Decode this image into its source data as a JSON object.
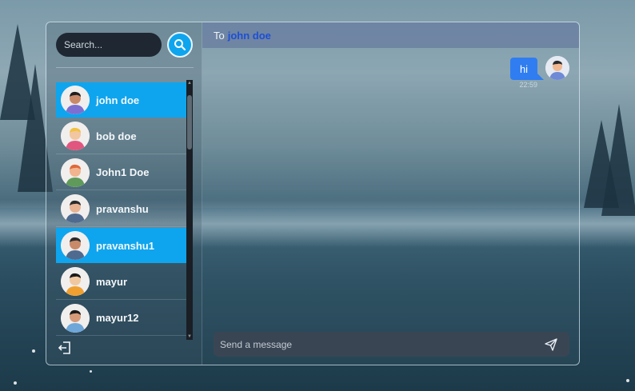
{
  "search": {
    "placeholder": "Search..."
  },
  "contacts": [
    {
      "name": "john doe",
      "active": true
    },
    {
      "name": "bob doe",
      "active": false
    },
    {
      "name": "John1 Doe",
      "active": false
    },
    {
      "name": "pravanshu",
      "active": false
    },
    {
      "name": "pravanshu1",
      "active": true
    },
    {
      "name": "mayur",
      "active": false
    },
    {
      "name": "mayur12",
      "active": false
    }
  ],
  "chat": {
    "to_label": "To",
    "recipient": "john doe",
    "messages": [
      {
        "text": "hi",
        "time": "22:59",
        "outgoing": true
      }
    ],
    "composer_placeholder": "Send a message"
  },
  "icons": {
    "search": "search-icon",
    "logout": "logout-icon",
    "send": "send-icon",
    "avatar": "avatar-icon"
  },
  "colors": {
    "accent": "#0ea5ee",
    "bubble": "#2f7df0",
    "header": "#697da0",
    "recipient": "#1d4fd6"
  }
}
